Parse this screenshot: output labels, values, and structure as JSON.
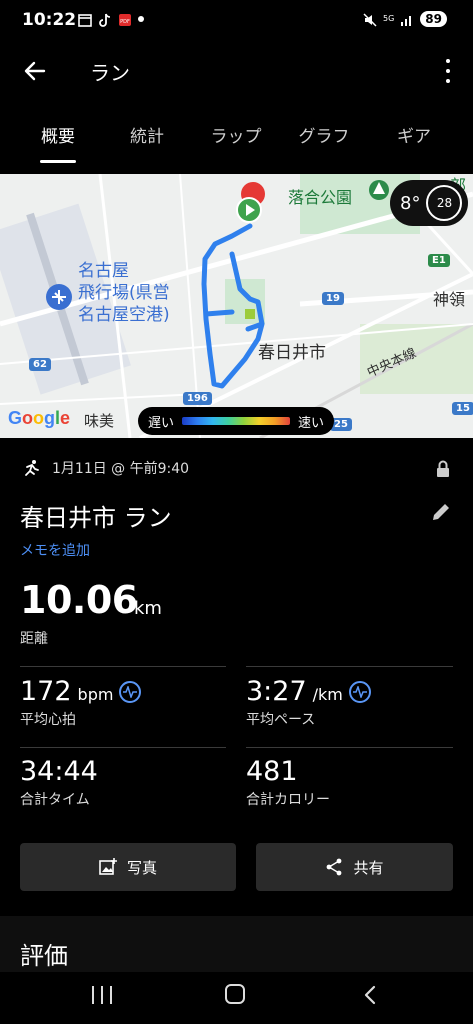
{
  "status_bar": {
    "time": "10:22",
    "battery": "89",
    "network": "5G"
  },
  "appbar": {
    "title": "ラン",
    "back_icon": "arrow-left-icon",
    "more_icon": "more-vert-icon"
  },
  "tabs": [
    {
      "label": "概要",
      "active": true
    },
    {
      "label": "統計",
      "active": false
    },
    {
      "label": "ラップ",
      "active": false
    },
    {
      "label": "グラフ",
      "active": false
    },
    {
      "label": "ギア",
      "active": false
    }
  ],
  "map": {
    "labels": {
      "park": "落合公園",
      "airport": "名古屋\n飛行場(県営\n名古屋空港)",
      "city": "春日井市",
      "line": "中央本線",
      "kamiryo": "神領",
      "cut": "部",
      "ajiyoshi": "味美"
    },
    "shields": {
      "r19": "19",
      "r196": "196",
      "r62": "62",
      "r25": "25",
      "r15": "15",
      "e1": "E1"
    },
    "weather": {
      "temp": "8°",
      "wind": "28"
    },
    "google": "Google",
    "legend": {
      "slow": "遅い",
      "fast": "速い"
    }
  },
  "activity": {
    "date": "1月11日 @ 午前9:40",
    "title": "春日井市 ラン",
    "memo": "メモを追加"
  },
  "distance": {
    "value": "10.06",
    "unit": "km",
    "label": "距離"
  },
  "stats": {
    "heart_rate": {
      "value": "172",
      "unit": "bpm",
      "label": "平均心拍"
    },
    "pace": {
      "value": "3:27",
      "unit": "/km",
      "label": "平均ペース"
    },
    "time": {
      "value": "34:44",
      "label": "合計タイム"
    },
    "calories": {
      "value": "481",
      "label": "合計カロリー"
    }
  },
  "actions": {
    "photo": "写真",
    "share": "共有"
  },
  "rating_section": {
    "title": "評価"
  },
  "colors": {
    "accent_blue": "#4d8ff5",
    "route": "#2f80ed",
    "start_green": "#3fa34d"
  }
}
